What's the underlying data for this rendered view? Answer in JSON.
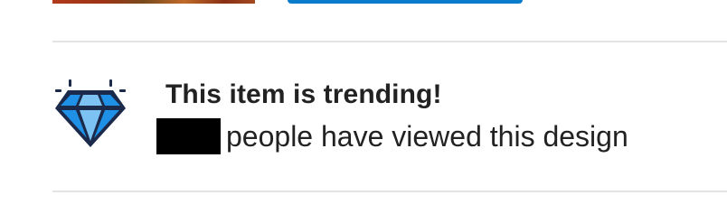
{
  "banner": {
    "title": "This item is trending!",
    "views_suffix": "people have viewed this design",
    "icon": "diamond-icon",
    "colors": {
      "icon_outline": "#1b2a4a",
      "icon_fill": "#1e90e6",
      "accent_button": "#0b7ccb"
    }
  }
}
